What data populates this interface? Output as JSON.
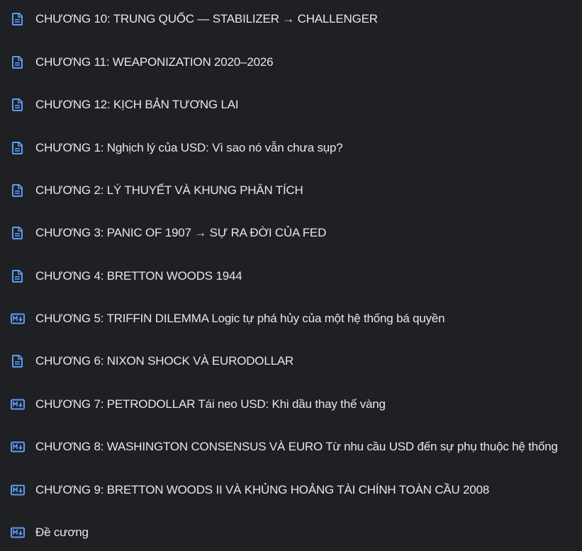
{
  "files": [
    {
      "label": "CHƯƠNG 10: TRUNG QUỐC — STABILIZER → CHALLENGER",
      "icon": "document-icon"
    },
    {
      "label": "CHƯƠNG 11: WEAPONIZATION 2020–2026",
      "icon": "document-icon"
    },
    {
      "label": "CHƯƠNG 12: KỊCH BẢN TƯƠNG LAI",
      "icon": "document-icon"
    },
    {
      "label": "CHƯƠNG 1: Nghịch lý của USD: Vì sao nó vẫn chưa sụp?",
      "icon": "document-icon"
    },
    {
      "label": "CHƯƠNG 2: LÝ THUYẾT VÀ KHUNG PHÂN TÍCH",
      "icon": "document-icon"
    },
    {
      "label": "CHƯƠNG 3: PANIC OF 1907 → SỰ RA ĐỜI CỦA FED",
      "icon": "document-icon"
    },
    {
      "label": "CHƯƠNG 4: BRETTON WOODS 1944",
      "icon": "document-icon"
    },
    {
      "label": "CHƯƠNG 5: TRIFFIN DILEMMA Logic tự phá hủy của một hệ thống bá quyền",
      "icon": "markdown-icon"
    },
    {
      "label": "CHƯƠNG 6: NIXON SHOCK VÀ EURODOLLAR",
      "icon": "document-icon"
    },
    {
      "label": "CHƯƠNG 7: PETRODOLLAR Tái neo USD: Khi dầu thay thế vàng",
      "icon": "markdown-icon"
    },
    {
      "label": "CHƯƠNG 8: WASHINGTON CONSENSUS VÀ EURO Từ nhu cầu USD đến sự phụ thuộc hệ thống",
      "icon": "markdown-icon"
    },
    {
      "label": "CHƯƠNG 9: BRETTON WOODS II VÀ KHỦNG HOẢNG TÀI CHÍNH TOÀN CẦU 2008",
      "icon": "markdown-icon"
    },
    {
      "label": "Đề cương",
      "icon": "markdown-icon"
    }
  ],
  "colors": {
    "background": "#1f2023",
    "text": "#e6e7ea",
    "icon_blue": "#5b9cf5"
  }
}
